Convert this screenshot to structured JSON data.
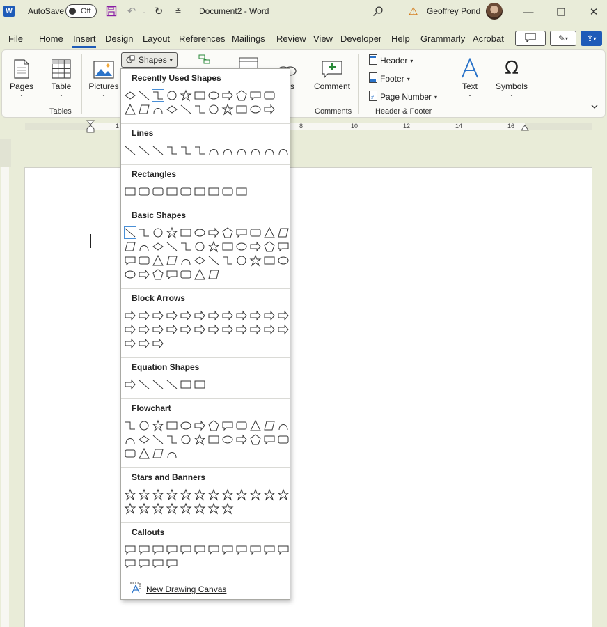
{
  "titlebar": {
    "autosave_label": "AutoSave",
    "autosave_state": "Off",
    "doc_title": "Document2 - Word",
    "user_name": "Geoffrey Pond"
  },
  "menu": {
    "tabs": [
      "File",
      "Home",
      "Insert",
      "Design",
      "Layout",
      "References",
      "Mailings",
      "Review",
      "View",
      "Developer",
      "Help",
      "Grammarly",
      "Acrobat"
    ],
    "active_tab": "Insert"
  },
  "ribbon": {
    "pages": "Pages",
    "table": "Table",
    "pictures": "Pictures",
    "shapes": "Shapes",
    "links": "ks",
    "comment": "Comment",
    "header": "Header",
    "footer": "Footer",
    "page_number": "Page Number",
    "text": "Text",
    "symbols": "Symbols",
    "group_tables": "Tables",
    "group_comments": "Comments",
    "group_header_footer": "Header & Footer"
  },
  "ruler": {
    "ticks": [
      "1",
      "8",
      "10",
      "12",
      "14",
      "16"
    ]
  },
  "gallery": {
    "sections": [
      {
        "title": "Recently Used Shapes",
        "count": 22
      },
      {
        "title": "Lines",
        "count": 12
      },
      {
        "title": "Rectangles",
        "count": 9
      },
      {
        "title": "Basic Shapes",
        "count": 43
      },
      {
        "title": "Block Arrows",
        "count": 27
      },
      {
        "title": "Equation Shapes",
        "count": 6
      },
      {
        "title": "Flowchart",
        "count": 28
      },
      {
        "title": "Stars and Banners",
        "count": 20
      },
      {
        "title": "Callouts",
        "count": 16
      }
    ],
    "new_canvas": "New Drawing Canvas"
  }
}
